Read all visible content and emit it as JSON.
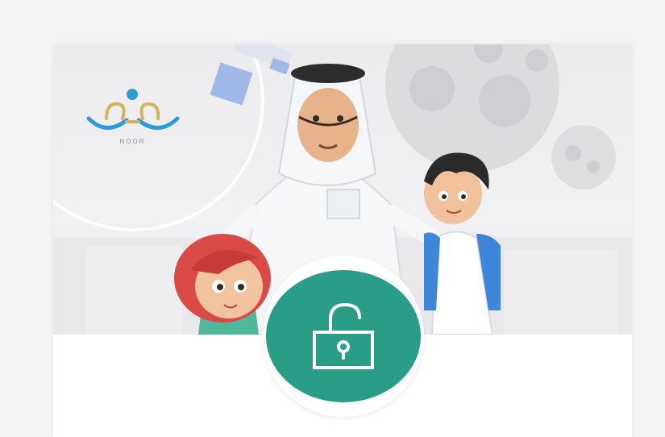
{
  "logo": {
    "text": "NOOR",
    "icon": "noor-logo"
  },
  "unlock_button": {
    "icon": "unlock-icon"
  },
  "colors": {
    "accent": "#2a9d86",
    "logo_blue": "#2f9ad8",
    "logo_gold": "#d7b25c"
  }
}
